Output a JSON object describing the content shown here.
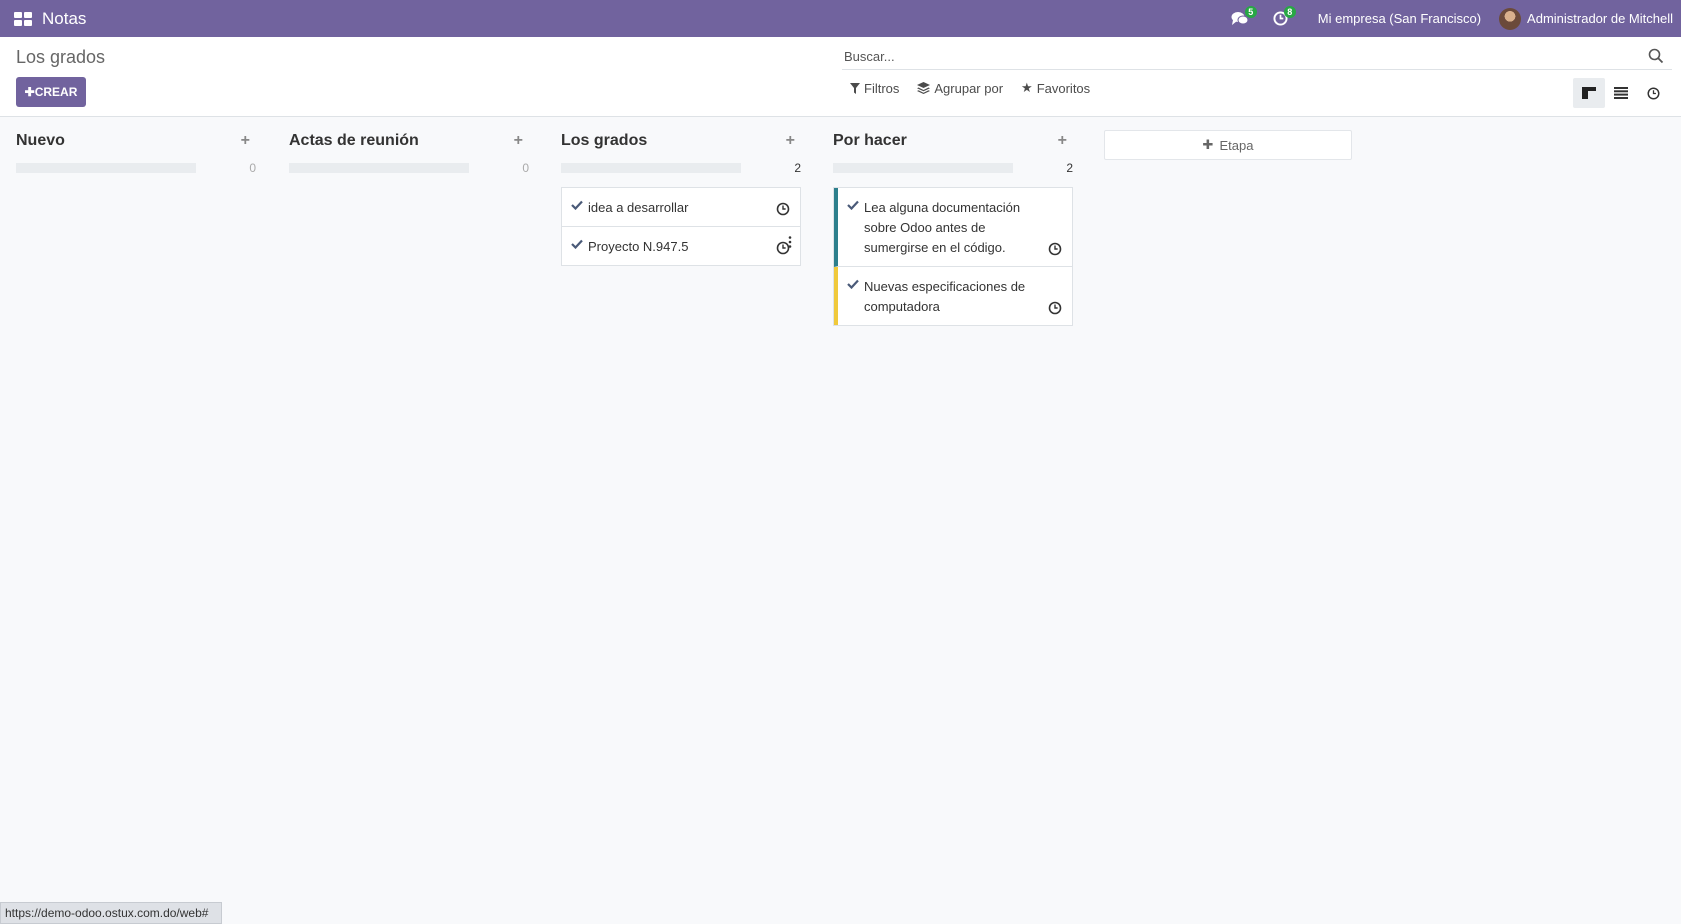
{
  "navbar": {
    "app_name": "Notas",
    "messages_count": "5",
    "activities_count": "8",
    "company": "Mi empresa (San Francisco)",
    "user_name": "Administrador de Mitchell"
  },
  "control_panel": {
    "breadcrumb": "Los grados",
    "create_label": "CREAR",
    "search_placeholder": "Buscar...",
    "filters_label": "Filtros",
    "group_by_label": "Agrupar por",
    "favorites_label": "Favoritos"
  },
  "kanban": {
    "columns": [
      {
        "title": "Nuevo",
        "count": "0",
        "cards": []
      },
      {
        "title": "Actas de reunión",
        "count": "0",
        "cards": []
      },
      {
        "title": "Los grados",
        "count": "2",
        "cards": [
          {
            "text": "idea a desarrollar"
          },
          {
            "text": "Proyecto N.947.5"
          }
        ]
      },
      {
        "title": "Por hacer",
        "count": "2",
        "cards": [
          {
            "text": "Lea alguna documentación sobre Odoo antes de sumergirse en el código.",
            "color": "#2d7f8c"
          },
          {
            "text": "Nuevas especificaciones de computadora",
            "color": "#f0c93b"
          }
        ]
      }
    ],
    "add_stage_label": "Etapa"
  },
  "status_url": "https://demo-odoo.ostux.com.do/web#",
  "colors": {
    "brand": "#71639e",
    "badge": "#28a745"
  }
}
